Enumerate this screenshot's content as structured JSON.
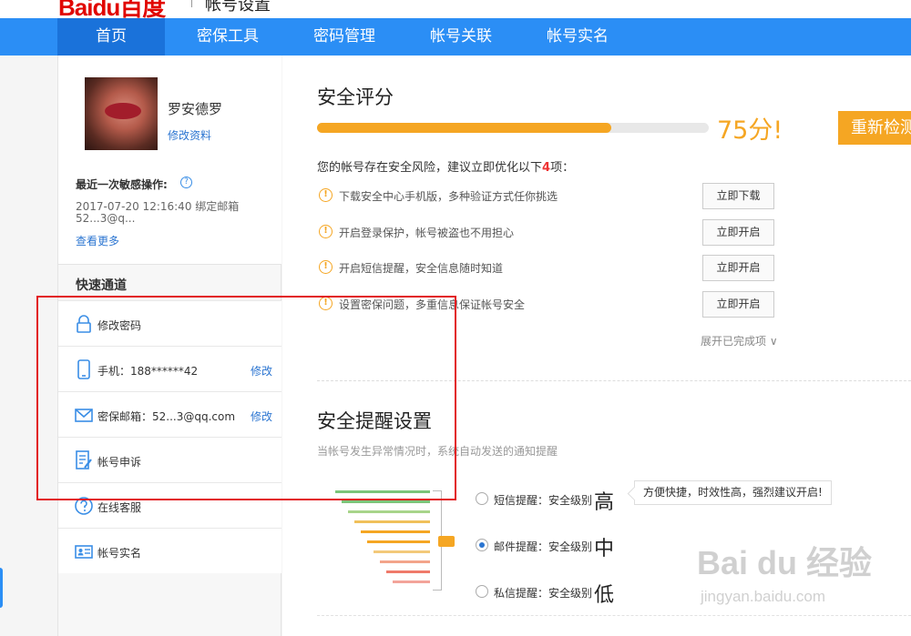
{
  "header": {
    "logo_text": "Baidu百度",
    "title": "帐号设置"
  },
  "nav": {
    "items": [
      {
        "label": "首页",
        "active": true
      },
      {
        "label": "密保工具"
      },
      {
        "label": "密码管理"
      },
      {
        "label": "帐号关联"
      },
      {
        "label": "帐号实名"
      }
    ]
  },
  "profile": {
    "username": "罗安德罗",
    "edit_label": "修改资料",
    "recent_title": "最近一次敏感操作:",
    "help_icon": "?",
    "recent_line1": "2017-07-20 12:16:40   绑定邮箱",
    "recent_line2": "52...3@q...",
    "see_more": "查看更多"
  },
  "quick": {
    "title": "快速通道",
    "items": [
      {
        "icon": "lock-icon",
        "label": "修改密码",
        "edit": ""
      },
      {
        "icon": "phone-icon",
        "label": "手机：188******42",
        "edit": "修改"
      },
      {
        "icon": "mail-icon",
        "label": "密保邮箱：52...3@qq.com",
        "edit": "修改"
      },
      {
        "icon": "appeal-icon",
        "label": "帐号申诉",
        "edit": ""
      },
      {
        "icon": "help-circle-icon",
        "label": "在线客服",
        "edit": ""
      },
      {
        "icon": "id-card-icon",
        "label": "帐号实名",
        "edit": ""
      }
    ]
  },
  "security": {
    "title": "安全评分",
    "score": 75,
    "score_max": 100,
    "score_text": "75分!",
    "recheck_label": "重新检测",
    "risk_prefix": "您的帐号存在安全风险，建议立即优化以下",
    "risk_count": "4",
    "risk_suffix": "项：",
    "risks": [
      {
        "label": "下载安全中心手机版，多种验证方式任你挑选",
        "button": "立即下载"
      },
      {
        "label": "开启登录保护，帐号被盗也不用担心",
        "button": "立即开启"
      },
      {
        "label": "开启短信提醒，安全信息随时知道",
        "button": "立即开启"
      },
      {
        "label": "设置密保问题，多重信息保证帐号安全",
        "button": "立即开启"
      }
    ],
    "expand_label": "展开已完成项 ∨"
  },
  "reminder": {
    "title": "安全提醒设置",
    "subtitle": "当帐号发生异常情况时，系统自动发送的通知提醒",
    "options": [
      {
        "label": "短信提醒：安全级别",
        "level": "高",
        "checked": false
      },
      {
        "label": "邮件提醒：安全级别",
        "level": "中",
        "checked": true
      },
      {
        "label": "私信提醒：安全级别",
        "level": "低",
        "checked": false
      }
    ],
    "tip": "方便快捷，时效性高，强烈建议开启!",
    "bar_colors": [
      "#7cc57a",
      "#7cc57a",
      "#a8d48a",
      "#f0c05a",
      "#f5a623",
      "#f5a623",
      "#f3c97a",
      "#f3a48a",
      "#ef7a6a",
      "#f3a49a"
    ],
    "pointer_color": "#f5a623"
  },
  "watermark": {
    "main": "Bai du 经验",
    "sub": "jingyan.baidu.com"
  },
  "colors": {
    "nav_bg": "#2b8ef5",
    "nav_active": "#1a72da",
    "score": "#f5a623",
    "link": "#2b75d1",
    "annotation": "#e2191e"
  }
}
